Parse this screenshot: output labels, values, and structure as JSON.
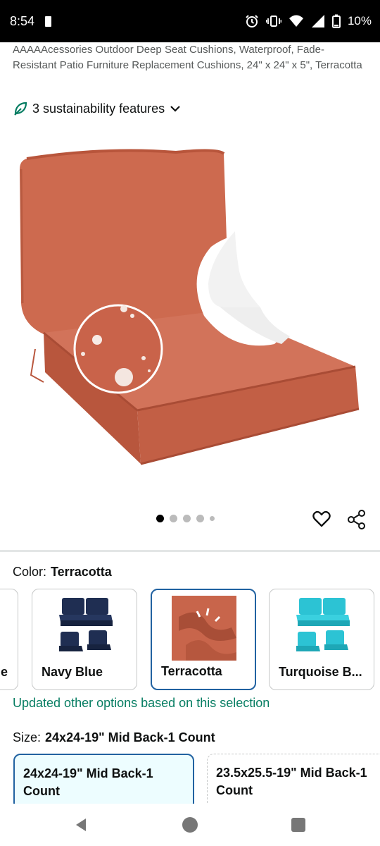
{
  "status_bar": {
    "time": "8:54",
    "battery": "10%",
    "icons": [
      "alarm-icon",
      "vibrate-icon",
      "wifi-icon",
      "signal-icon",
      "battery-icon"
    ]
  },
  "product": {
    "title": "AAAAAcessories Outdoor Deep Seat Cushions, Waterproof, Fade-Resistant Patio Furniture Replacement Cushions, 24\" x 24\" x 5\", Terracotta",
    "sustainability": "3 sustainability features",
    "image_count": 5,
    "active_image": 1
  },
  "colors": {
    "accent": "#2162a1",
    "terracotta": "#cf6a4e",
    "success": "#067d62"
  },
  "color_selector": {
    "label": "Color:",
    "selected": "Terracotta",
    "options": [
      {
        "label": "e"
      },
      {
        "label": "Navy Blue"
      },
      {
        "label": "Terracotta"
      },
      {
        "label": "Turquoise B..."
      }
    ],
    "update_message": "Updated other options based on this selection"
  },
  "size_selector": {
    "label": "Size:",
    "selected": "24x24-19\" Mid Back-1 Count",
    "options": [
      {
        "label": "24x24-19\" Mid Back-1 Count"
      },
      {
        "label": "23.5x25.5-19\" Mid Back-1 Count"
      }
    ]
  }
}
